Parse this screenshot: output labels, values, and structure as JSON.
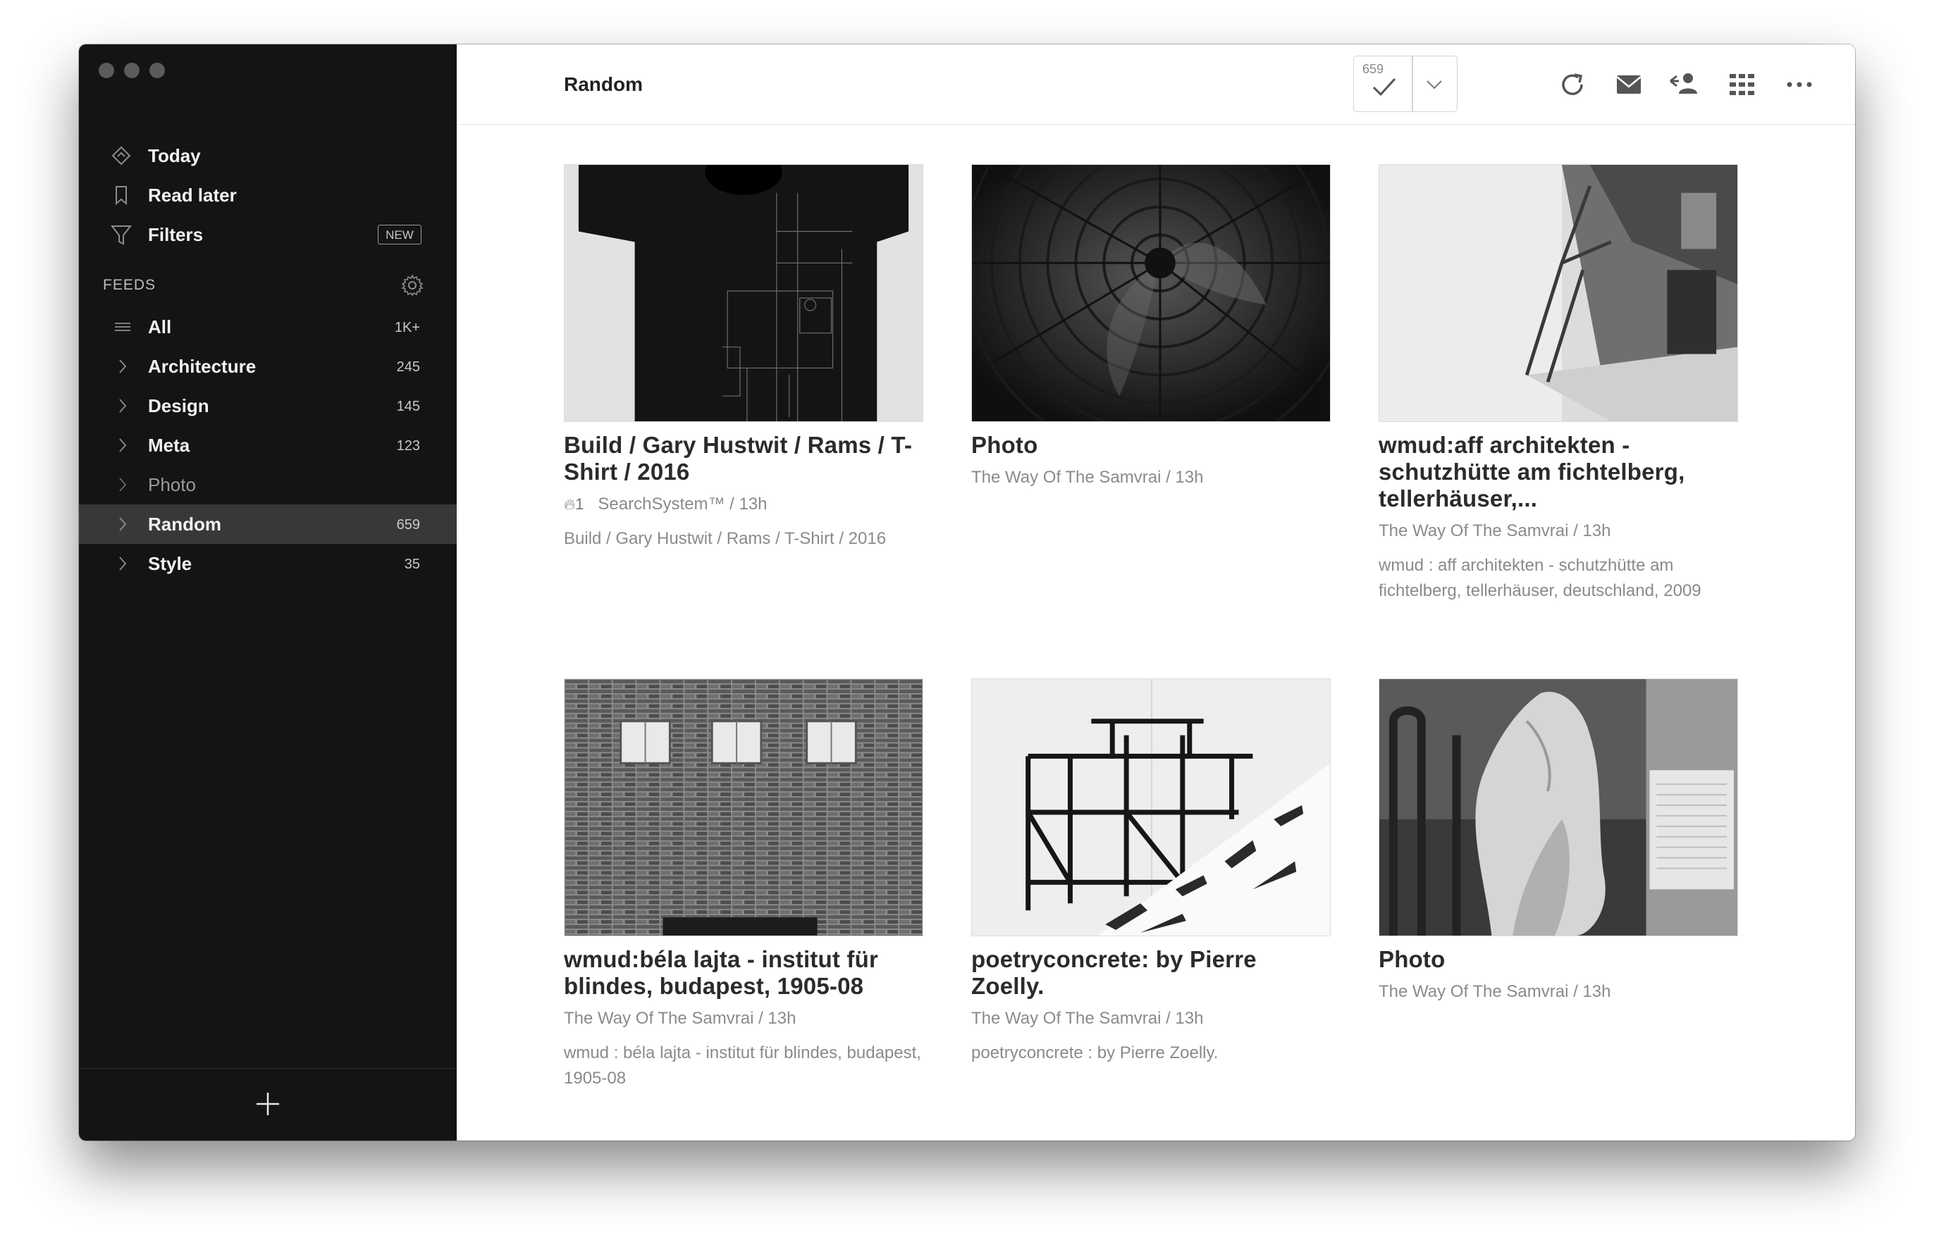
{
  "sidebar": {
    "nav": [
      {
        "label": "Today",
        "icon": "today-icon"
      },
      {
        "label": "Read later",
        "icon": "bookmark-icon"
      },
      {
        "label": "Filters",
        "icon": "filter-icon",
        "badge": "NEW"
      }
    ],
    "feeds_title": "FEEDS",
    "feeds": [
      {
        "label": "All",
        "count": "1K+"
      },
      {
        "label": "Architecture",
        "count": "245"
      },
      {
        "label": "Design",
        "count": "145"
      },
      {
        "label": "Meta",
        "count": "123"
      },
      {
        "label": "Photo",
        "count": ""
      },
      {
        "label": "Random",
        "count": "659"
      },
      {
        "label": "Style",
        "count": "35"
      }
    ]
  },
  "header": {
    "title": "Random",
    "unread_count": "659"
  },
  "articles": [
    {
      "title": "Build / Gary Hustwit / Rams / T-Shirt / 2016",
      "flame": "1",
      "meta": "SearchSystem™ / 13h",
      "excerpt": "Build / Gary Hustwit / Rams / T-Shirt / 2016"
    },
    {
      "title": "Photo",
      "meta": "The Way Of The Samvrai / 13h",
      "excerpt": ""
    },
    {
      "title": "wmud:aff architekten - schutzhütte am fichtelberg, tellerhäuser,...",
      "meta": "The Way Of The Samvrai / 13h",
      "excerpt": "wmud : aff architekten - schutzhütte am fichtelberg, tellerhäuser, deutschland, 2009"
    },
    {
      "title": "wmud:béla lajta - institut für blindes, budapest, 1905-08",
      "meta": "The Way Of The Samvrai / 13h",
      "excerpt": "wmud : béla lajta - institut für blindes, budapest, 1905-08"
    },
    {
      "title": "poetryconcrete: by Pierre Zoelly.",
      "meta": "The Way Of The Samvrai / 13h",
      "excerpt": "poetryconcrete : by Pierre Zoelly."
    },
    {
      "title": "Photo",
      "meta": "The Way Of The Samvrai / 13h",
      "excerpt": ""
    }
  ],
  "colors": {
    "sidebar_bg": "#141414",
    "sidebar_active": "#383838",
    "accent_text": "#2b2b2b",
    "muted": "#8a8a8a"
  }
}
